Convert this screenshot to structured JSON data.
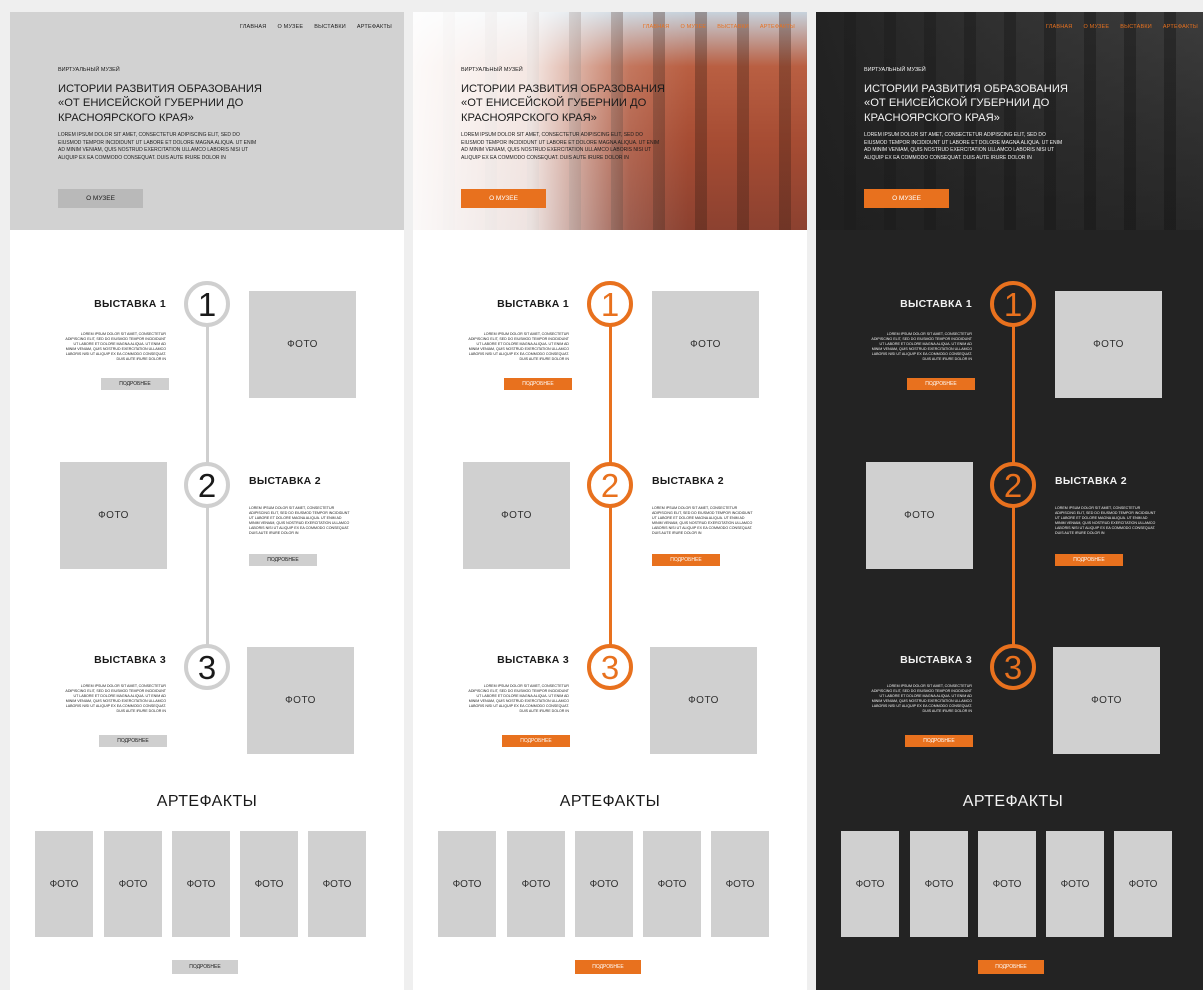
{
  "colors": {
    "accent": "#e8711e",
    "wire_gray": "#cfcfcf",
    "dark_bg": "#232323",
    "text_dark": "#1a1a1a",
    "text_light": "#f2f2f2"
  },
  "hero": {
    "nav": [
      "ГЛАВНАЯ",
      "О МУЗЕЕ",
      "ВЫСТАВКИ",
      "АРТЕФАКТЫ"
    ],
    "kicker": "ВИРТУАЛЬНЫЙ МУЗЕЙ",
    "title": "ИСТОРИИ РАЗВИТИЯ ОБРАЗОВАНИЯ «ОТ ЕНИСЕЙСКОЙ ГУБЕРНИИ ДО КРАСНОЯРСКОГО КРАЯ»",
    "lead": "LOREM IPSUM DOLOR SIT AMET, CONSECTETUR ADIPISCING ELIT, SED DO EIUSMOD TEMPOR INCIDIDUNT UT LABORE ET DOLORE MAGNA ALIQUA. UT ENIM AD MINIM VENIAM, QUIS NOSTRUD EXERCITATION ULLAMCO LABORIS NISI UT ALIQUIP EX EA COMMODO CONSEQUAT. DUIS AUTE IRURE DOLOR IN",
    "cta": "О МУЗЕЕ"
  },
  "exhibitions": [
    {
      "number": "1",
      "title": "ВЫСТАВКА 1",
      "desc": "LOREM IPSUM DOLOR SIT AMET, CONSECTETUR ADIPISCING ELIT, SED DO EIUSMOD TEMPOR INCIDIDUNT UT LABORE ET DOLORE MAGNA ALIQUA. UT ENIM AD MINIM VENIAM, QUIS NOSTRUD EXERCITATION ULLAMCO LABORIS NISI UT ALIQUIP EX EA COMMODO CONSEQUAT. DUIS AUTE IRURE DOLOR IN",
      "button": "ПОДРОБНЕЕ",
      "photo": "ФОТО"
    },
    {
      "number": "2",
      "title": "ВЫСТАВКА 2",
      "desc": "LOREM IPSUM DOLOR SIT AMET, CONSECTETUR ADIPISCING ELIT, SED DO EIUSMOD TEMPOR INCIDIDUNT UT LABORE ET DOLORE MAGNA ALIQUA. UT ENIM AD MINIM VENIAM, QUIS NOSTRUD EXERCITATION ULLAMCO LABORIS NISI UT ALIQUIP EX EA COMMODO CONSEQUAT. DUIS AUTE IRURE DOLOR IN",
      "button": "ПОДРОБНЕЕ",
      "photo": "ФОТО"
    },
    {
      "number": "3",
      "title": "ВЫСТАВКА 3",
      "desc": "LOREM IPSUM DOLOR SIT AMET, CONSECTETUR ADIPISCING ELIT, SED DO EIUSMOD TEMPOR INCIDIDUNT UT LABORE ET DOLORE MAGNA ALIQUA. UT ENIM AD MINIM VENIAM, QUIS NOSTRUD EXERCITATION ULLAMCO LABORIS NISI UT ALIQUIP EX EA COMMODO CONSEQUAT. DUIS AUTE IRURE DOLOR IN",
      "button": "ПОДРОБНЕЕ",
      "photo": "ФОТО"
    }
  ],
  "artifacts": {
    "title": "АРТЕФАКТЫ",
    "photos": [
      "ФОТО",
      "ФОТО",
      "ФОТО",
      "ФОТО",
      "ФОТО"
    ],
    "button": "ПОДРОБНЕЕ"
  },
  "boards": [
    {
      "id": "wireframe",
      "variant": "gray"
    },
    {
      "id": "light",
      "variant": "light"
    },
    {
      "id": "dark",
      "variant": "dark"
    }
  ]
}
